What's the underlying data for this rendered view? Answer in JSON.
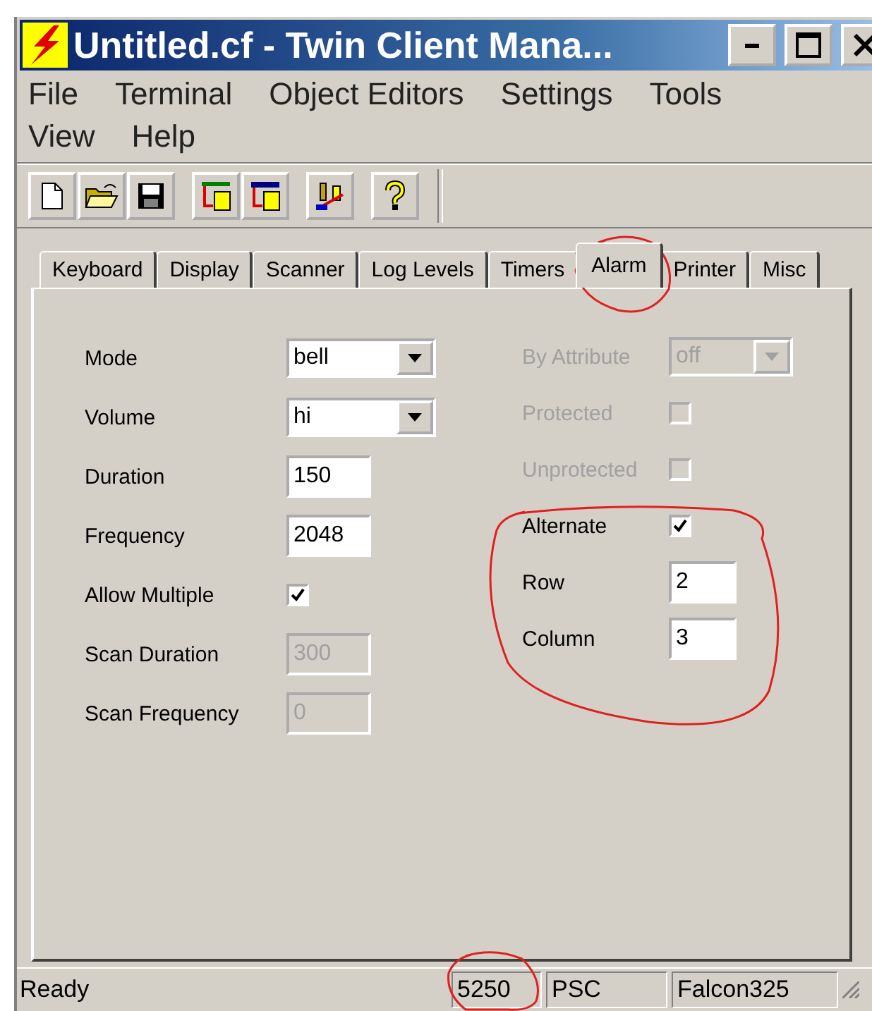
{
  "window": {
    "title": "Untitled.cf - Twin Client Mana..."
  },
  "menu_rows": [
    {
      "items": [
        "File",
        "Terminal",
        "Object Editors",
        "Settings",
        "Tools"
      ]
    },
    {
      "items": [
        "View",
        "Help"
      ]
    }
  ],
  "toolbar": [
    {
      "kind": "new"
    },
    {
      "kind": "open"
    },
    {
      "kind": "save"
    },
    {
      "kind": "sep"
    },
    {
      "kind": "table-in"
    },
    {
      "kind": "table-out"
    },
    {
      "kind": "sep"
    },
    {
      "kind": "tools"
    },
    {
      "kind": "sep"
    },
    {
      "kind": "help"
    }
  ],
  "tabs": [
    {
      "label": "Keyboard",
      "selected": false
    },
    {
      "label": "Display",
      "selected": false
    },
    {
      "label": "Scanner",
      "selected": false
    },
    {
      "label": "Log Levels",
      "selected": false
    },
    {
      "label": "Timers",
      "selected": false
    },
    {
      "label": "Alarm",
      "selected": true
    },
    {
      "label": "Printer",
      "selected": false
    },
    {
      "label": "Misc",
      "selected": false
    }
  ],
  "form_left": [
    {
      "kind": "dropdown",
      "label": "Mode",
      "value": "bell",
      "disabled": false,
      "label_dimmed": false
    },
    {
      "kind": "dropdown",
      "label": "Volume",
      "value": "hi",
      "disabled": false,
      "label_dimmed": false
    },
    {
      "kind": "text",
      "label": "Duration",
      "value": "150",
      "disabled": false,
      "label_dimmed": false
    },
    {
      "kind": "text",
      "label": "Frequency",
      "value": "2048",
      "disabled": false,
      "label_dimmed": false
    },
    {
      "kind": "checkbox",
      "label": "Allow Multiple",
      "checked": true,
      "disabled": false,
      "label_dimmed": false
    },
    {
      "kind": "text",
      "label": "Scan Duration",
      "value": "300",
      "disabled": true,
      "label_dimmed": false
    },
    {
      "kind": "text",
      "label": "Scan Frequency",
      "value": "0",
      "disabled": true,
      "label_dimmed": false
    }
  ],
  "form_right": [
    {
      "kind": "dropdown",
      "label": "By Attribute",
      "value": "off",
      "disabled": true,
      "label_dimmed": true
    },
    {
      "kind": "checkbox",
      "label": "Protected",
      "checked": false,
      "disabled": true,
      "label_dimmed": true
    },
    {
      "kind": "checkbox",
      "label": "Unprotected",
      "checked": false,
      "disabled": true,
      "label_dimmed": true
    },
    {
      "kind": "checkbox",
      "label": "Alternate",
      "checked": true,
      "disabled": false,
      "label_dimmed": false
    },
    {
      "kind": "text",
      "label": "Row",
      "value": "2",
      "disabled": false,
      "label_dimmed": false
    },
    {
      "kind": "text",
      "label": "Column",
      "value": "3",
      "disabled": false,
      "label_dimmed": false
    }
  ],
  "status_bar": {
    "message": "Ready",
    "panels": [
      "5250",
      "PSC",
      "Falcon325"
    ]
  }
}
